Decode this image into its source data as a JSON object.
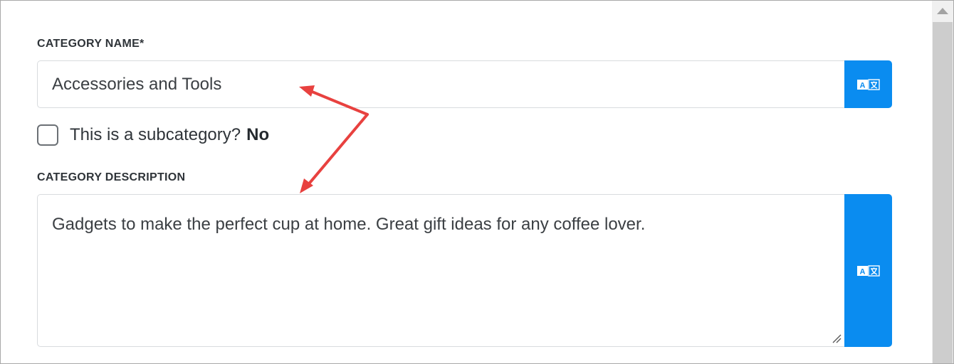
{
  "form": {
    "category_name": {
      "label": "CATEGORY NAME*",
      "value": "Accessories and Tools",
      "translate_icon": "translate-icon"
    },
    "subcategory": {
      "label": "This is a subcategory?",
      "value": "No",
      "checked": false
    },
    "category_description": {
      "label": "CATEGORY DESCRIPTION",
      "value": "Gadgets to make the perfect cup at home. Great gift ideas for any coffee lover.",
      "translate_icon": "translate-icon"
    }
  },
  "colors": {
    "accent": "#0a8cf0",
    "annotation_arrow": "#e8413f"
  }
}
